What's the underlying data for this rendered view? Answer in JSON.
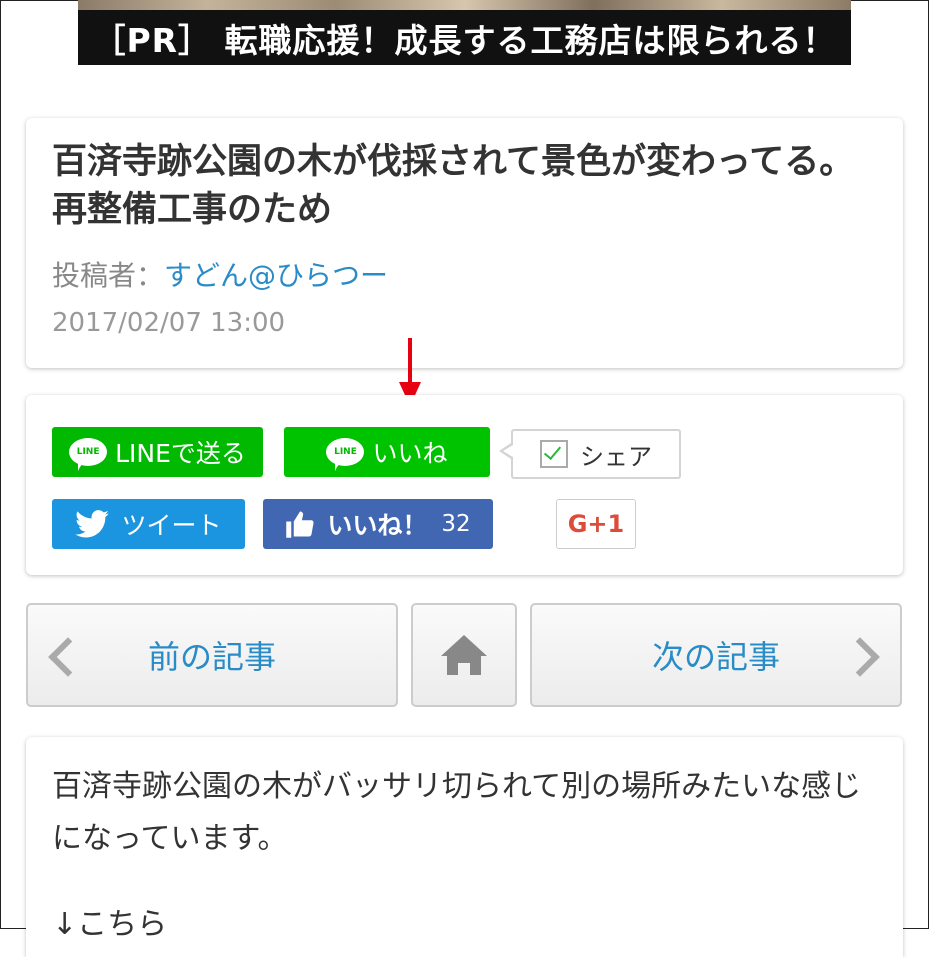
{
  "ad": {
    "text": "［PR］ 転職応援！成長する工務店は限られる！"
  },
  "article": {
    "title": "百済寺跡公園の木が伐採されて景色が変わってる。再整備工事のため",
    "author_label": "投稿者：",
    "author_name": "すどん@ひらつー",
    "date": "2017/02/07 13:00"
  },
  "share": {
    "line_send": "LINEで送る",
    "line_like": "いいね",
    "line_icon": "LINE",
    "share": "シェア",
    "tweet": "ツイート",
    "fb_like": "いいね！",
    "fb_count": "32",
    "gplus": "G+1"
  },
  "nav": {
    "prev": "前の記事",
    "next": "次の記事"
  },
  "body": {
    "paragraph": "百済寺跡公園の木がバッサリ切られて別の場所みたいな感じになっています。",
    "next_line": "↓こちら"
  },
  "colors": {
    "line_green": "#00b900",
    "twitter_blue": "#1b95e0",
    "facebook_blue": "#4267b2",
    "link_blue": "#2a8cc7",
    "arrow_red": "#e60012"
  },
  "icons": [
    "line-icon",
    "checkbox-icon",
    "twitter-bird-icon",
    "thumbs-up-icon",
    "chevron-left-icon",
    "home-icon",
    "chevron-right-icon",
    "red-arrow-icon"
  ]
}
